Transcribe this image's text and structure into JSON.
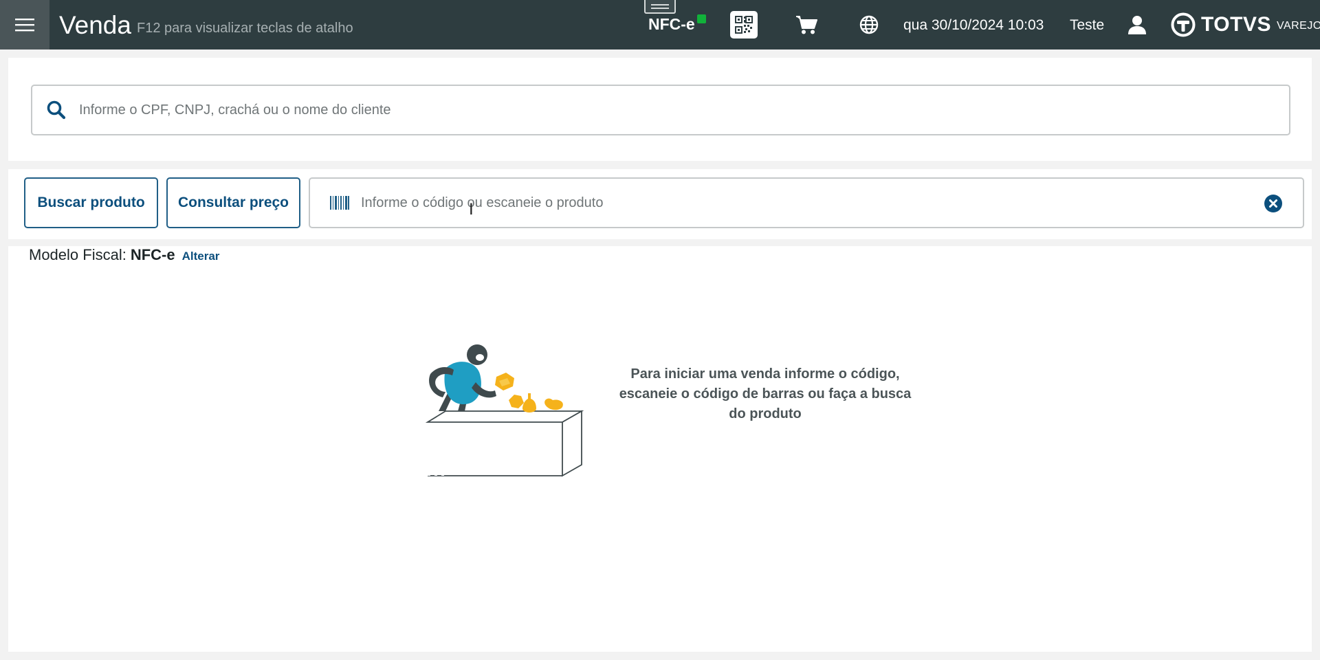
{
  "header": {
    "page_title": "Venda",
    "shortcut_hint": "F12 para visualizar teclas de atalho",
    "fiscal_model": "NFC-e",
    "datetime": "qua 30/10/2024 10:03",
    "user": "Teste",
    "brand_name": "TOTVS",
    "brand_sub": "VAREJO",
    "icons": [
      "menu-icon",
      "qr-code-icon",
      "cart-icon",
      "globe-icon",
      "user-icon",
      "totvs-logo-icon"
    ]
  },
  "client_search": {
    "placeholder": "Informe o CPF, CNPJ, crachá ou o nome do cliente",
    "value": ""
  },
  "product_bar": {
    "buscar_label": "Buscar produto",
    "consultar_label": "Consultar preço",
    "placeholder": "Informe o código ou escaneie o produto",
    "value": ""
  },
  "fiscal": {
    "label": "Modelo Fiscal:",
    "value": "NFC-e",
    "change_link": "Alterar"
  },
  "empty_state": {
    "message": "Para iniciar uma venda informe o código, escaneie o código de barras ou faça a busca do produto"
  },
  "colors": {
    "topbar": "#2e3d40",
    "accent": "#0c4f7d",
    "status_online": "#11b23a",
    "illustration_blue": "#1f9ec3",
    "illustration_yellow": "#f5b21b"
  }
}
